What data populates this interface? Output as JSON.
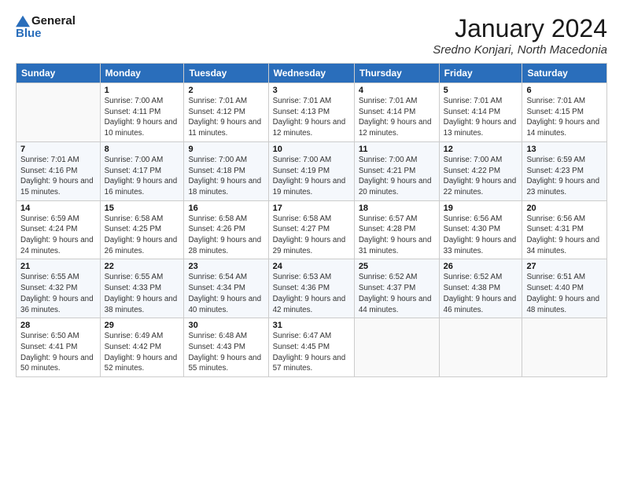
{
  "logo": {
    "line1": "General",
    "line2": "Blue"
  },
  "title": "January 2024",
  "location": "Sredno Konjari, North Macedonia",
  "days_of_week": [
    "Sunday",
    "Monday",
    "Tuesday",
    "Wednesday",
    "Thursday",
    "Friday",
    "Saturday"
  ],
  "weeks": [
    [
      {
        "day": "",
        "sunrise": "",
        "sunset": "",
        "daylight": ""
      },
      {
        "day": "1",
        "sunrise": "Sunrise: 7:00 AM",
        "sunset": "Sunset: 4:11 PM",
        "daylight": "Daylight: 9 hours and 10 minutes."
      },
      {
        "day": "2",
        "sunrise": "Sunrise: 7:01 AM",
        "sunset": "Sunset: 4:12 PM",
        "daylight": "Daylight: 9 hours and 11 minutes."
      },
      {
        "day": "3",
        "sunrise": "Sunrise: 7:01 AM",
        "sunset": "Sunset: 4:13 PM",
        "daylight": "Daylight: 9 hours and 12 minutes."
      },
      {
        "day": "4",
        "sunrise": "Sunrise: 7:01 AM",
        "sunset": "Sunset: 4:14 PM",
        "daylight": "Daylight: 9 hours and 12 minutes."
      },
      {
        "day": "5",
        "sunrise": "Sunrise: 7:01 AM",
        "sunset": "Sunset: 4:14 PM",
        "daylight": "Daylight: 9 hours and 13 minutes."
      },
      {
        "day": "6",
        "sunrise": "Sunrise: 7:01 AM",
        "sunset": "Sunset: 4:15 PM",
        "daylight": "Daylight: 9 hours and 14 minutes."
      }
    ],
    [
      {
        "day": "7",
        "sunrise": "Sunrise: 7:01 AM",
        "sunset": "Sunset: 4:16 PM",
        "daylight": "Daylight: 9 hours and 15 minutes."
      },
      {
        "day": "8",
        "sunrise": "Sunrise: 7:00 AM",
        "sunset": "Sunset: 4:17 PM",
        "daylight": "Daylight: 9 hours and 16 minutes."
      },
      {
        "day": "9",
        "sunrise": "Sunrise: 7:00 AM",
        "sunset": "Sunset: 4:18 PM",
        "daylight": "Daylight: 9 hours and 18 minutes."
      },
      {
        "day": "10",
        "sunrise": "Sunrise: 7:00 AM",
        "sunset": "Sunset: 4:19 PM",
        "daylight": "Daylight: 9 hours and 19 minutes."
      },
      {
        "day": "11",
        "sunrise": "Sunrise: 7:00 AM",
        "sunset": "Sunset: 4:21 PM",
        "daylight": "Daylight: 9 hours and 20 minutes."
      },
      {
        "day": "12",
        "sunrise": "Sunrise: 7:00 AM",
        "sunset": "Sunset: 4:22 PM",
        "daylight": "Daylight: 9 hours and 22 minutes."
      },
      {
        "day": "13",
        "sunrise": "Sunrise: 6:59 AM",
        "sunset": "Sunset: 4:23 PM",
        "daylight": "Daylight: 9 hours and 23 minutes."
      }
    ],
    [
      {
        "day": "14",
        "sunrise": "Sunrise: 6:59 AM",
        "sunset": "Sunset: 4:24 PM",
        "daylight": "Daylight: 9 hours and 24 minutes."
      },
      {
        "day": "15",
        "sunrise": "Sunrise: 6:58 AM",
        "sunset": "Sunset: 4:25 PM",
        "daylight": "Daylight: 9 hours and 26 minutes."
      },
      {
        "day": "16",
        "sunrise": "Sunrise: 6:58 AM",
        "sunset": "Sunset: 4:26 PM",
        "daylight": "Daylight: 9 hours and 28 minutes."
      },
      {
        "day": "17",
        "sunrise": "Sunrise: 6:58 AM",
        "sunset": "Sunset: 4:27 PM",
        "daylight": "Daylight: 9 hours and 29 minutes."
      },
      {
        "day": "18",
        "sunrise": "Sunrise: 6:57 AM",
        "sunset": "Sunset: 4:28 PM",
        "daylight": "Daylight: 9 hours and 31 minutes."
      },
      {
        "day": "19",
        "sunrise": "Sunrise: 6:56 AM",
        "sunset": "Sunset: 4:30 PM",
        "daylight": "Daylight: 9 hours and 33 minutes."
      },
      {
        "day": "20",
        "sunrise": "Sunrise: 6:56 AM",
        "sunset": "Sunset: 4:31 PM",
        "daylight": "Daylight: 9 hours and 34 minutes."
      }
    ],
    [
      {
        "day": "21",
        "sunrise": "Sunrise: 6:55 AM",
        "sunset": "Sunset: 4:32 PM",
        "daylight": "Daylight: 9 hours and 36 minutes."
      },
      {
        "day": "22",
        "sunrise": "Sunrise: 6:55 AM",
        "sunset": "Sunset: 4:33 PM",
        "daylight": "Daylight: 9 hours and 38 minutes."
      },
      {
        "day": "23",
        "sunrise": "Sunrise: 6:54 AM",
        "sunset": "Sunset: 4:34 PM",
        "daylight": "Daylight: 9 hours and 40 minutes."
      },
      {
        "day": "24",
        "sunrise": "Sunrise: 6:53 AM",
        "sunset": "Sunset: 4:36 PM",
        "daylight": "Daylight: 9 hours and 42 minutes."
      },
      {
        "day": "25",
        "sunrise": "Sunrise: 6:52 AM",
        "sunset": "Sunset: 4:37 PM",
        "daylight": "Daylight: 9 hours and 44 minutes."
      },
      {
        "day": "26",
        "sunrise": "Sunrise: 6:52 AM",
        "sunset": "Sunset: 4:38 PM",
        "daylight": "Daylight: 9 hours and 46 minutes."
      },
      {
        "day": "27",
        "sunrise": "Sunrise: 6:51 AM",
        "sunset": "Sunset: 4:40 PM",
        "daylight": "Daylight: 9 hours and 48 minutes."
      }
    ],
    [
      {
        "day": "28",
        "sunrise": "Sunrise: 6:50 AM",
        "sunset": "Sunset: 4:41 PM",
        "daylight": "Daylight: 9 hours and 50 minutes."
      },
      {
        "day": "29",
        "sunrise": "Sunrise: 6:49 AM",
        "sunset": "Sunset: 4:42 PM",
        "daylight": "Daylight: 9 hours and 52 minutes."
      },
      {
        "day": "30",
        "sunrise": "Sunrise: 6:48 AM",
        "sunset": "Sunset: 4:43 PM",
        "daylight": "Daylight: 9 hours and 55 minutes."
      },
      {
        "day": "31",
        "sunrise": "Sunrise: 6:47 AM",
        "sunset": "Sunset: 4:45 PM",
        "daylight": "Daylight: 9 hours and 57 minutes."
      },
      {
        "day": "",
        "sunrise": "",
        "sunset": "",
        "daylight": ""
      },
      {
        "day": "",
        "sunrise": "",
        "sunset": "",
        "daylight": ""
      },
      {
        "day": "",
        "sunrise": "",
        "sunset": "",
        "daylight": ""
      }
    ]
  ]
}
